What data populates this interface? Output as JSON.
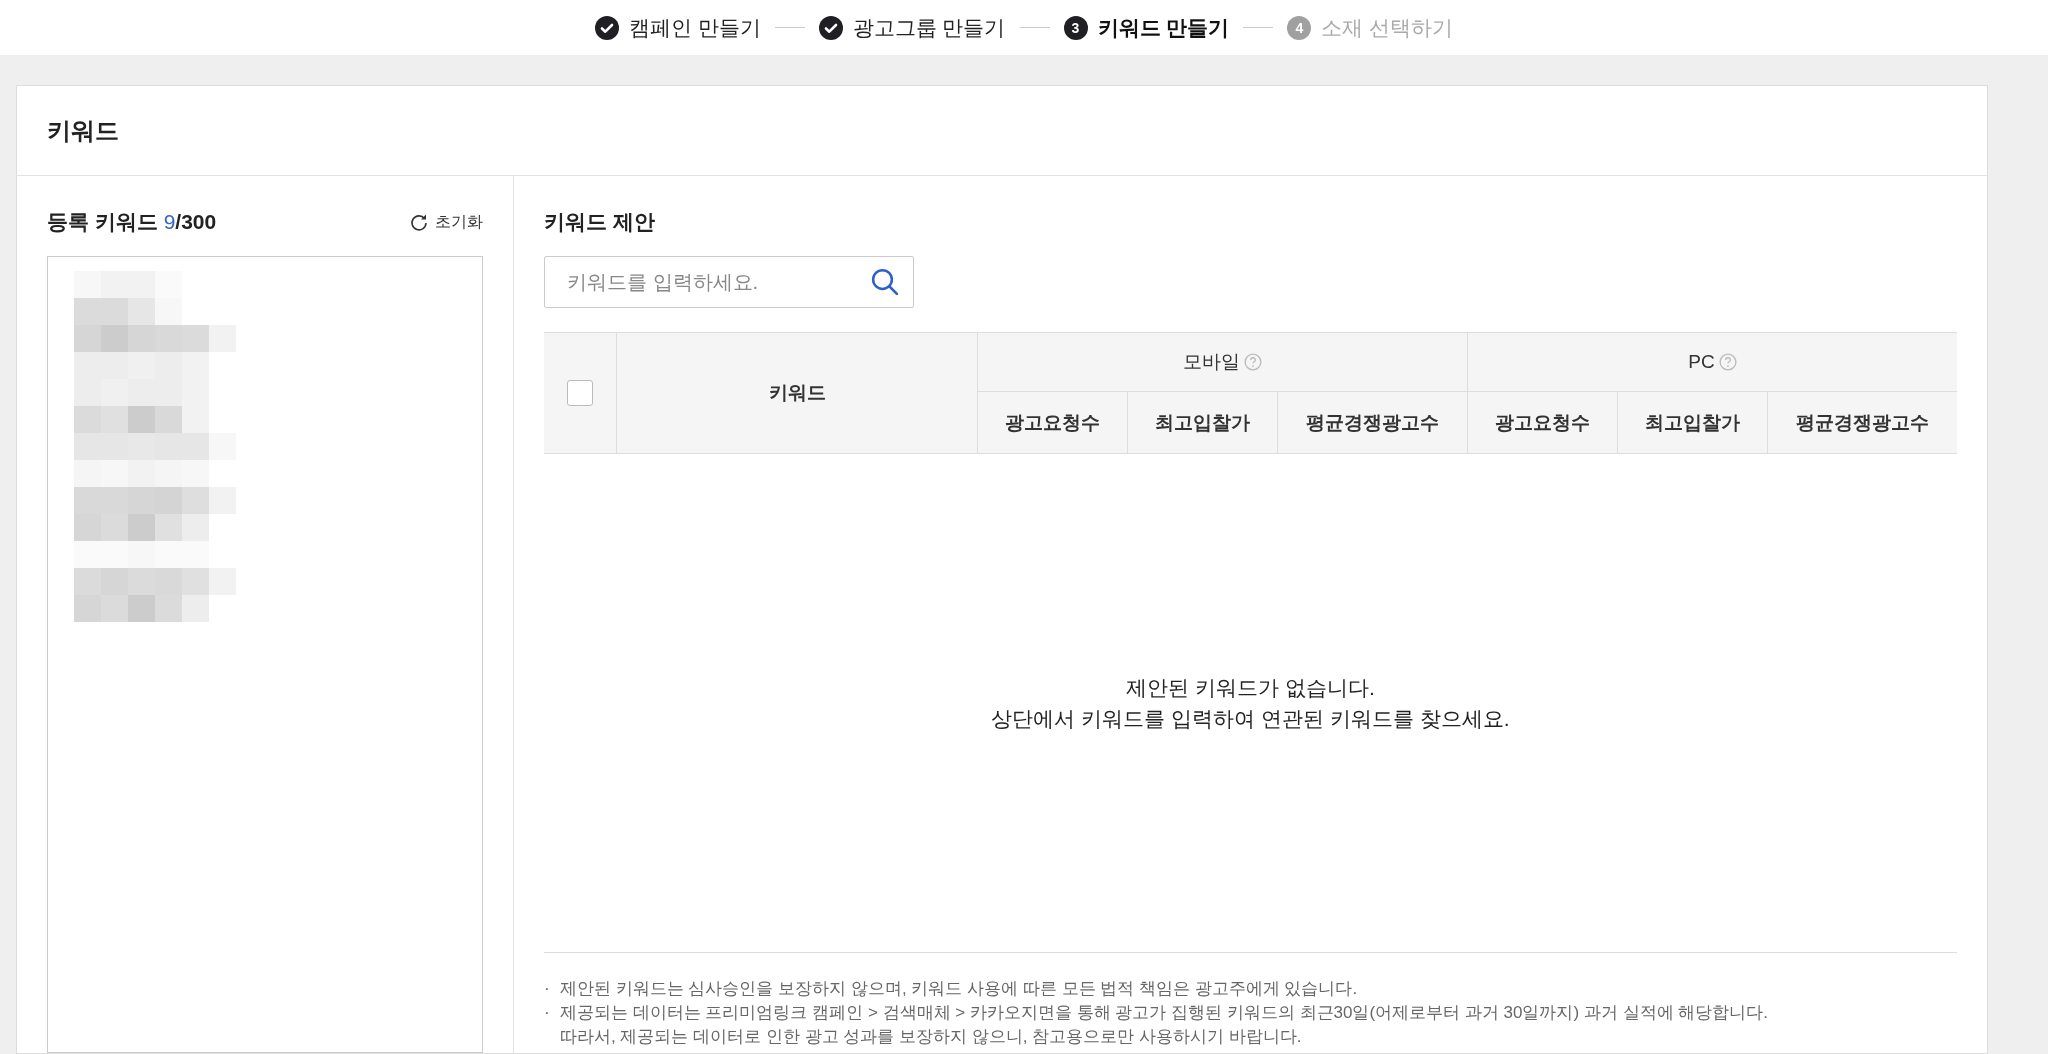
{
  "steps": [
    {
      "label": "캠페인 만들기",
      "completed": true,
      "selected": false
    },
    {
      "label": "광고그룹 만들기",
      "completed": true,
      "selected": false
    },
    {
      "number": "3",
      "label": "키워드 만들기",
      "completed": false,
      "selected": true
    },
    {
      "number": "4",
      "label": "소재 선택하기",
      "completed": false,
      "selected": false
    }
  ],
  "card": {
    "title": "키워드"
  },
  "registered": {
    "title": "등록 키워드 ",
    "count": "9",
    "total": "/300",
    "reset_label": "초기화"
  },
  "suggest": {
    "title": "키워드 제안",
    "search": {
      "placeholder": "키워드를 입력하세요."
    },
    "table": {
      "select_all": {
        "checked": false
      },
      "keyword_column": "키워드",
      "groups": [
        {
          "label": "모바일",
          "columns": [
            "광고요청수",
            "최고입찰가",
            "평균경쟁광고수"
          ]
        },
        {
          "label": "PC",
          "columns": [
            "광고요청수",
            "최고입찰가",
            "평균경쟁광고수"
          ]
        }
      ],
      "empty_lines": [
        "제안된 키워드가 없습니다.",
        "상단에서 키워드를 입력하여 연관된 키워드를 찾으세요."
      ]
    },
    "notes": [
      {
        "bullet": "·",
        "text": "제안된 키워드는 심사승인을 보장하지 않으며, 키워드 사용에 따른 모든 법적 책임은 광고주에게 있습니다."
      },
      {
        "bullet": "·",
        "text": "제공되는 데이터는 프리미엄링크 캠페인 > 검색매체 > 카카오지면을 통해 광고가 집행된 키워드의 최근30일(어제로부터 과거 30일까지) 과거 실적에 해당합니다."
      },
      {
        "text": "따라서, 제공되는 데이터로 인한 광고 성과를 보장하지 않으니, 참고용으로만 사용하시기 바랍니다."
      }
    ]
  }
}
